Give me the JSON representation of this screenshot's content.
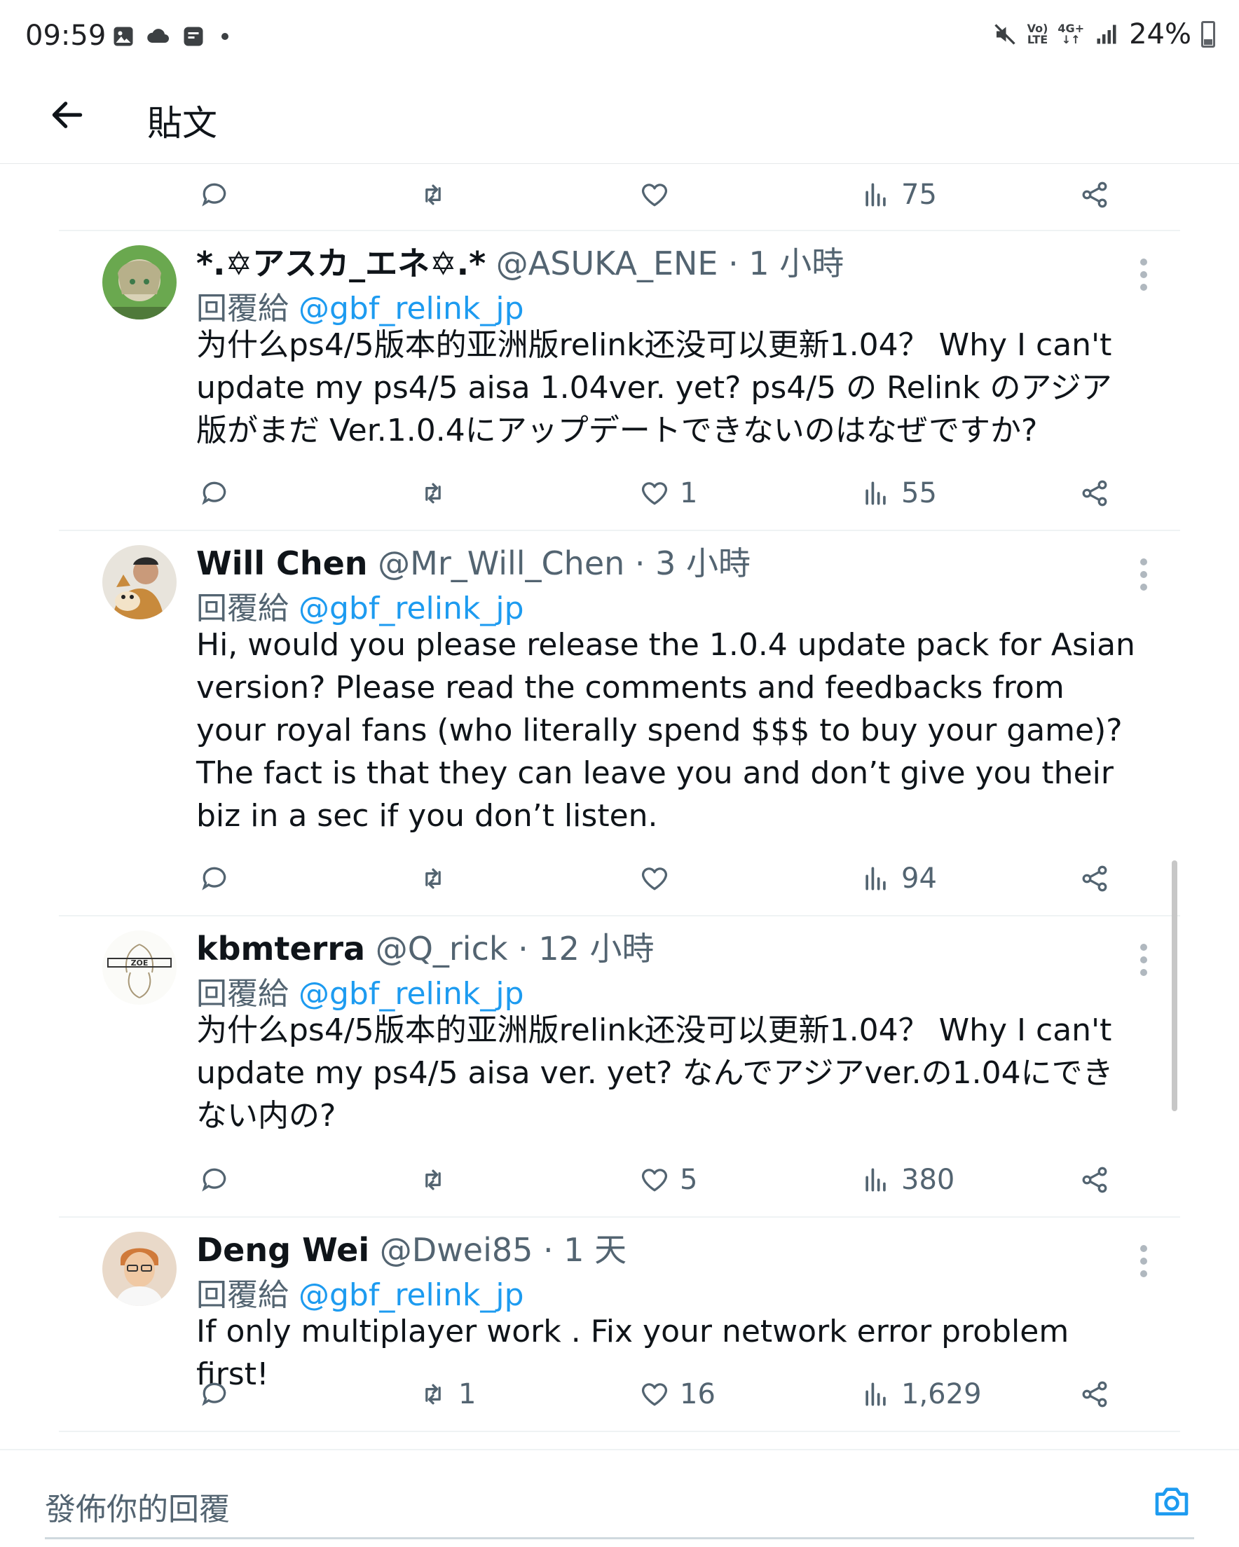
{
  "status_bar": {
    "time": "09:59",
    "net_top": "Vo)",
    "net_bottom": "LTE",
    "net2_top": "4G+",
    "net2_bottom": "↓↑",
    "battery": "24%"
  },
  "header": {
    "title": "貼文"
  },
  "first_row": {
    "reply": "",
    "retweet": "",
    "like": "",
    "views": "75"
  },
  "tweets": [
    {
      "name": "*.✡アスカ_エネ✡.*",
      "meta": "@ASUKA_ENE · 1 小時",
      "reply_prefix": "回覆給 ",
      "mention": "@gbf_relink_jp",
      "text": "为什么ps4/5版本的亚洲版relink还没可以更新1.04？ Why I can't update my ps4/5 aisa 1.04ver. yet? ps4/5 の Relink のアジア版がまだ Ver.1.0.4にアップデートできないのはなぜですか?",
      "retweets": "",
      "likes": "1",
      "views": "55"
    },
    {
      "name": "Will Chen",
      "meta": "@Mr_Will_Chen · 3 小時",
      "reply_prefix": "回覆給 ",
      "mention": "@gbf_relink_jp",
      "text": "Hi, would you please release the 1.0.4 update pack for Asian version? Please read the comments and feedbacks from your royal fans (who literally spend $$$ to buy your game)? The fact is that they can leave you and don’t give you their biz in a sec if you don’t listen.",
      "retweets": "",
      "likes": "",
      "views": "94"
    },
    {
      "name": "kbmterra",
      "meta": "@Q_rick · 12 小時",
      "reply_prefix": "回覆給 ",
      "mention": "@gbf_relink_jp",
      "text": "为什么ps4/5版本的亚洲版relink还没可以更新1.04？ Why I can't update my ps4/5 aisa ver. yet? なんでアジアver.の1.04にできない内の?",
      "retweets": "",
      "likes": "5",
      "views": "380"
    },
    {
      "name": "Deng Wei",
      "meta": "@Dwei85 · 1 天",
      "reply_prefix": "回覆給 ",
      "mention": "@gbf_relink_jp",
      "text": "If only multiplayer work . Fix your network error problem first!",
      "retweets": "1",
      "likes": "16",
      "views": "1,629"
    }
  ],
  "compose": {
    "placeholder": "發佈你的回覆"
  },
  "colors": {
    "accent": "#1d9bf0",
    "muted": "#536471",
    "text": "#0f1419"
  }
}
